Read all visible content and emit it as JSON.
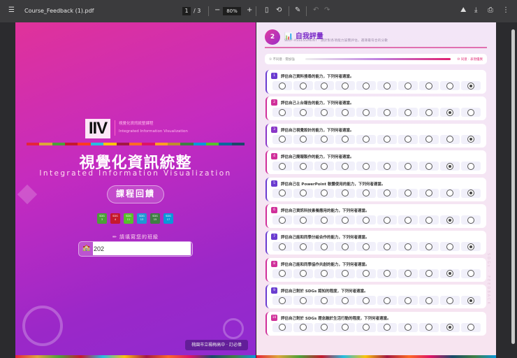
{
  "toolbar": {
    "filename": "Course_Feedback (1).pdf",
    "page_current": "1",
    "page_total": "/ 3",
    "zoom": "80%"
  },
  "cover": {
    "logo_text": "IIV",
    "logo_cn": "視覺化資訊統整課程",
    "logo_en": "Integrated Information Visualization",
    "title": "視覺化資訊統整",
    "subtitle": "Integrated Information Visualization",
    "feedback_button": "課程回饋",
    "sdgs": [
      {
        "label": "SDG",
        "num": "3",
        "color": "#4c9f38"
      },
      {
        "label": "SDG",
        "num": "4",
        "color": "#c5192d"
      },
      {
        "label": "SDG",
        "num": "11",
        "color": "#56c02b"
      },
      {
        "label": "SDG",
        "num": "13",
        "color": "#1f97d4"
      },
      {
        "label": "SDG",
        "num": "15",
        "color": "#3f7e44"
      },
      {
        "label": "SDG",
        "num": "17",
        "color": "#0a97d9"
      }
    ],
    "class_label": "✏ 請填寫您的班級",
    "class_value": "202",
    "footer": "桃園市立楊梅高中 · 訂必偉"
  },
  "assessment": {
    "section_num": "2",
    "title": "📊 自我評量",
    "subtitle": "SELF-ASSESSMENT · 請針對各項能力誠實評估，選擇最符合的分數",
    "scale_low": "① 不同意 · 需加強",
    "scale_high": "⑩ 同意 · 表現優異",
    "side_text": "SDGs · FEEDBACK",
    "questions": [
      {
        "num": "1",
        "text": "評估自己資料搜尋的能力，下列何者適當。",
        "selected": 10,
        "color": "#6a3cd0"
      },
      {
        "num": "2",
        "text": "評估自己上台報告的能力，下列何者適當。",
        "selected": 9,
        "color": "#d0309a"
      },
      {
        "num": "3",
        "text": "評估自己視覺設計的能力，下列何者適當。",
        "selected": 10,
        "color": "#8a36c8"
      },
      {
        "num": "4",
        "text": "評估自己簡報製作的能力，下列何者適當。",
        "selected": 9,
        "color": "#d0309a"
      },
      {
        "num": "5",
        "text": "評估自己在 PowerPoint 軟體使用的能力，下列何者適當。",
        "selected": 10,
        "color": "#6a3cd0"
      },
      {
        "num": "6",
        "text": "評估自己資訊科技素養應用的能力，下列何者適當。",
        "selected": 9,
        "color": "#d0309a"
      },
      {
        "num": "7",
        "text": "評估自己能和同學分組合作的能力，下列何者適當。",
        "selected": 10,
        "color": "#6a3cd0"
      },
      {
        "num": "8",
        "text": "評估自己能和同學協作共創的能力，下列何者適當。",
        "selected": 9,
        "color": "#d0309a"
      },
      {
        "num": "9",
        "text": "評估自己對於 SDGs 認知的程度，下列何者適當。",
        "selected": 10,
        "color": "#6a3cd0"
      },
      {
        "num": "10",
        "text": "評估自己對於 SDGs 理念融於生活行動的程度，下列何者適當。",
        "selected": 9,
        "color": "#d0309a"
      }
    ]
  }
}
